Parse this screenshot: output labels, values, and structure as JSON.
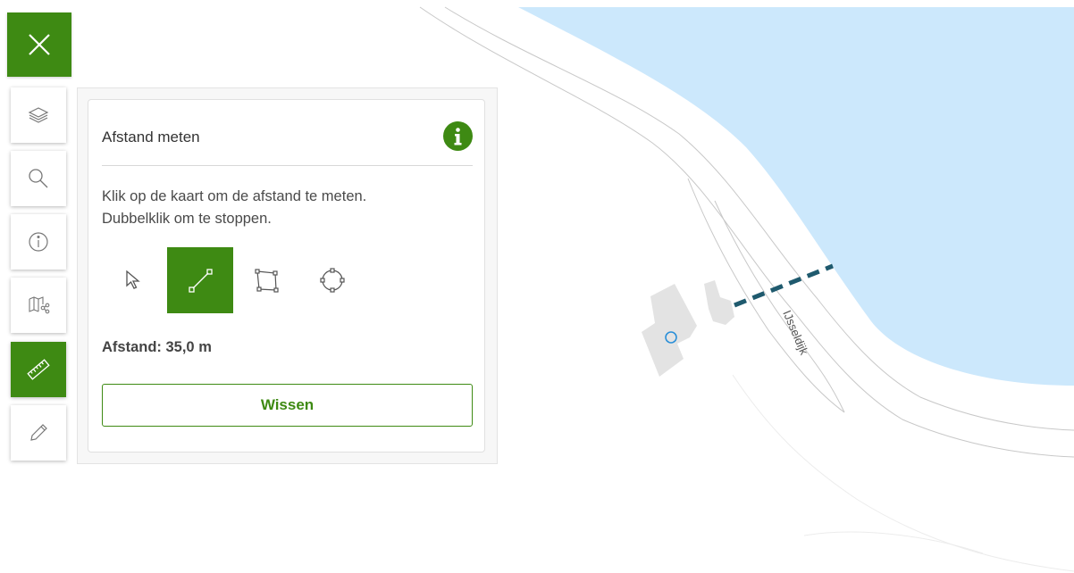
{
  "map": {
    "street_label": "IJsseldijk",
    "water_color": "#cce8fc",
    "measure_line_color": "#1f5a6e",
    "building_color": "#e3e3e3",
    "measured_distance_m": 35.0
  },
  "toolbar": {
    "close_icon": "close-icon",
    "items": [
      {
        "name": "layers",
        "icon": "layers-icon",
        "active": false
      },
      {
        "name": "search",
        "icon": "search-icon",
        "active": false
      },
      {
        "name": "info",
        "icon": "info-icon",
        "active": false
      },
      {
        "name": "map-share",
        "icon": "map-share-icon",
        "active": false
      },
      {
        "name": "measure",
        "icon": "ruler-icon",
        "active": true
      },
      {
        "name": "draw",
        "icon": "pencil-icon",
        "active": false
      }
    ],
    "accent_color": "#3e8a13"
  },
  "panel": {
    "title": "Afstand meten",
    "instruction_line1": "Klik op de kaart om de afstand te meten.",
    "instruction_line2": "Dubbelklik om te stoppen.",
    "tools": [
      {
        "name": "select",
        "icon": "pointer-icon",
        "active": false
      },
      {
        "name": "line",
        "icon": "line-measure-icon",
        "active": true
      },
      {
        "name": "polygon",
        "icon": "polygon-measure-icon",
        "active": false
      },
      {
        "name": "circle",
        "icon": "circle-measure-icon",
        "active": false
      }
    ],
    "distance_text": "Afstand: 35,0 m",
    "clear_button": "Wissen"
  }
}
